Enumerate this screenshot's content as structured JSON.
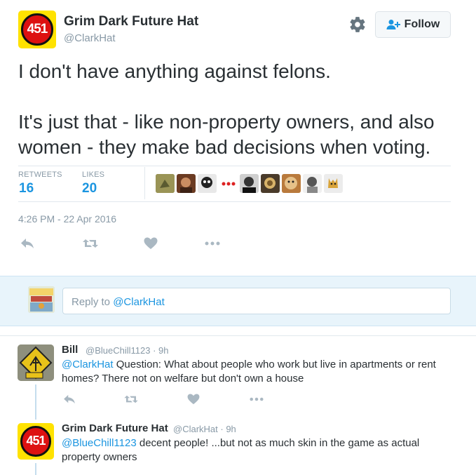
{
  "tweet": {
    "author_name": "Grim Dark Future Hat",
    "author_handle": "@ClarkHat",
    "avatar_text": "451",
    "follow_label": "Follow",
    "text": "I don't have anything against felons.\n\nIt's just that - like non-property owners, and also women - they make bad decisions when voting.",
    "retweets_label": "RETWEETS",
    "retweets_count": "16",
    "likes_label": "LIKES",
    "likes_count": "20",
    "timestamp": "4:26 PM - 22 Apr 2016"
  },
  "reply_box": {
    "prefix": "Reply to ",
    "mention": "@ClarkHat"
  },
  "replies": [
    {
      "name": "Bill",
      "handle": "@BlueChill1123",
      "time": "9h",
      "mention": "@ClarkHat",
      "text": " Question: What about people who work but live in apartments or rent homes? There not on welfare but don't own a house"
    },
    {
      "name": "Grim Dark Future Hat",
      "handle": "@ClarkHat",
      "time": "9h",
      "mention": "@BlueChill1123",
      "text": " decent people! ...but not as much skin in the game as actual property owners",
      "avatar_text": "451"
    }
  ],
  "icons": {
    "settings": "gear-icon",
    "follow": "add-user-icon",
    "reply": "reply-icon",
    "retweet": "retweet-icon",
    "like": "heart-icon",
    "more": "more-icon"
  },
  "colors": {
    "link": "#1b95e0",
    "muted": "#8899a6",
    "text": "#292f33",
    "action_icon": "#aab8c2",
    "reply_bar": "#e8f4fb"
  }
}
